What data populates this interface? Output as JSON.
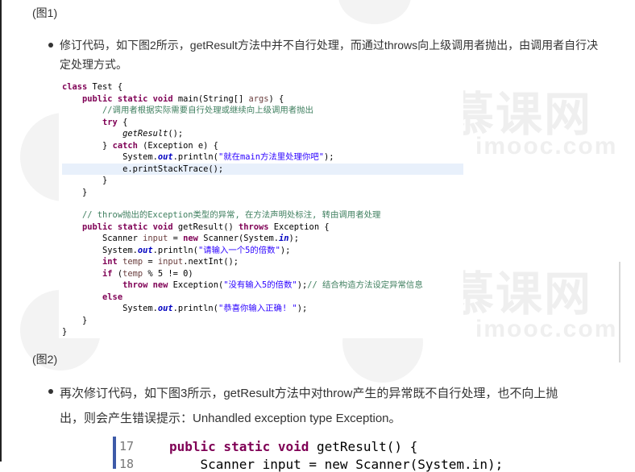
{
  "fig1_caption": "(图1)",
  "bullet1": {
    "line1": "修订代码，如下图2所示，getResult方法中并不自行处理，而通过throws向上级调用者抛出，由调用者自行决",
    "line2": "定处理方式。"
  },
  "code": {
    "l1a": "class",
    "l1b": " Test {",
    "l2a": "    ",
    "l2b": "public static void",
    "l2c": " main(String[] ",
    "l2d": "args",
    "l2e": ") {",
    "l3": "        //调用者根据实际需要自行处理或继续向上级调用者抛出",
    "l4a": "        ",
    "l4b": "try",
    "l4c": " {",
    "l5a": "            ",
    "l5b": "getResult",
    "l5c": "();",
    "l6a": "        } ",
    "l6b": "catch",
    "l6c": " (Exception e) {",
    "l7a": "            System.",
    "l7b": "out",
    "l7c": ".println(",
    "l7d": "\"就在main方法里处理你吧\"",
    "l7e": ");",
    "l8": "            e.printStackTrace();",
    "l9": "        }",
    "l10": "    }",
    "l11": "",
    "l12": "    // throw抛出的Exception类型的异常, 在方法声明处标注, 转由调用者处理",
    "l13a": "    ",
    "l13b": "public static void",
    "l13c": " getResult() ",
    "l13d": "throws",
    "l13e": " Exception {",
    "l14a": "        Scanner ",
    "l14b": "input",
    "l14c": " = ",
    "l14d": "new",
    "l14e": " Scanner(System.",
    "l14f": "in",
    "l14g": ");",
    "l15a": "        System.",
    "l15b": "out",
    "l15c": ".println(",
    "l15d": "\"请输入一个5的倍数\"",
    "l15e": ");",
    "l16a": "        ",
    "l16b": "int",
    "l16c": " ",
    "l16d": "temp",
    "l16e": " = ",
    "l16f": "input",
    "l16g": ".nextInt();",
    "l17a": "        ",
    "l17b": "if",
    "l17c": " (",
    "l17d": "temp",
    "l17e": " % 5 != 0)",
    "l18a": "            ",
    "l18b": "throw new",
    "l18c": " Exception(",
    "l18d": "\"没有输入5的倍数\"",
    "l18e": ");",
    "l18f": "// 结合构造方法设定异常信息",
    "l19a": "        ",
    "l19b": "else",
    "l20a": "            System.",
    "l20b": "out",
    "l20c": ".println(",
    "l20d": "\"恭喜你输入正确! \"",
    "l20e": ");",
    "l21": "    }",
    "l22": "}"
  },
  "fig2_caption": "(图2)",
  "bullet2": {
    "line1": "再次修订代码，如下图3所示，getResult方法中对throw产生的异常既不自行处理，也不向上抛",
    "line2": "出，则会产生错误提示：Unhandled exception type Exception。"
  },
  "snippet": {
    "lineno1": "17",
    "lineno2": "18",
    "code1a": "public static void",
    "code1b": " getResult() {",
    "code2": "    Scanner input = new Scanner(System.in);"
  },
  "watermark": {
    "text1": "慕课网",
    "text2": "imooc.com"
  }
}
